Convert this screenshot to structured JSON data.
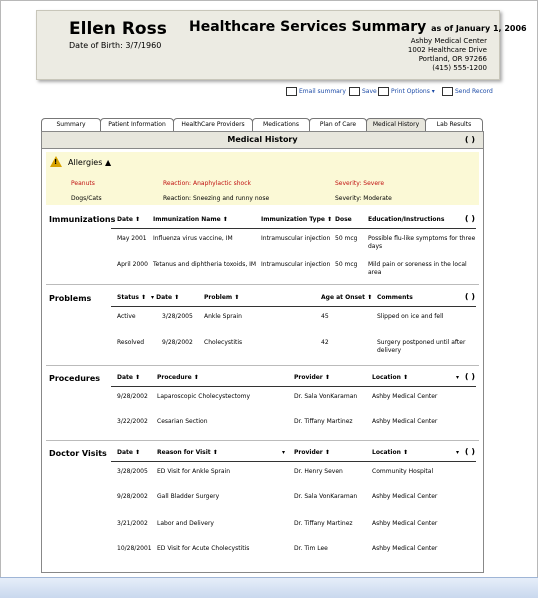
{
  "header": {
    "patient_name": "Ellen Ross",
    "dob": "Date of Birth: 3/7/1960",
    "title": "Healthcare Services Summary",
    "as_of": "as of January 1, 2006",
    "address": [
      "Ashby Medical Center",
      "1002 Healthcare Drive",
      "Portland, OR  97266",
      "(415) 555-1200"
    ]
  },
  "toolbar": {
    "email": "Email summary",
    "save": "Save",
    "print": "Print Options",
    "send": "Send Record"
  },
  "tabs": [
    "Summary",
    "Patient Information",
    "HealthCare Providers",
    "Medications",
    "Plan of Care",
    "Medical History",
    "Lab Results"
  ],
  "active_tab": "Medical History",
  "section_title": "Medical History",
  "allergies": {
    "title": "Allergies",
    "rows": [
      {
        "item": "Peanuts",
        "reaction": "Reaction:  Anaphylactic shock",
        "severity": "Severity:  Severe"
      },
      {
        "item": "Dogs/Cats",
        "reaction": "Reaction:  Sneezing and runny nose",
        "severity": "Severity:  Moderate"
      }
    ]
  },
  "immunizations": {
    "label": "Immunizations",
    "headers": [
      "Date",
      "Immunization Name",
      "Immunization Type",
      "Dose",
      "Education/Instructions"
    ],
    "rows": [
      {
        "date": "May 2001",
        "name": "Influenza virus vaccine, IM",
        "type": "Intramuscular injection",
        "dose": "50 mcg",
        "edu": "Possible flu-like symptoms for three days"
      },
      {
        "date": "April 2000",
        "name": "Tetanus and diphtheria toxoids, IM",
        "type": "Intramuscular injection",
        "dose": "50 mcg",
        "edu": "Mild pain or soreness in the local area"
      }
    ]
  },
  "problems": {
    "label": "Problems",
    "headers": [
      "Status",
      "Date",
      "Problem",
      "Age at Onset",
      "Comments"
    ],
    "rows": [
      {
        "status": "Active",
        "date": "3/28/2005",
        "problem": "Ankle Sprain",
        "age": "45",
        "comments": "Slipped on ice and fell"
      },
      {
        "status": "Resolved",
        "date": "9/28/2002",
        "problem": "Cholecystitis",
        "age": "42",
        "comments": "Surgery postponed until after delivery"
      }
    ]
  },
  "procedures": {
    "label": "Procedures",
    "headers": [
      "Date",
      "Procedure",
      "Provider",
      "Location"
    ],
    "rows": [
      {
        "date": "9/28/2002",
        "procedure": "Laparoscopic Cholecystectomy",
        "provider": "Dr. Sala VonKaraman",
        "location": "Ashby Medical Center"
      },
      {
        "date": "3/22/2002",
        "procedure": "Cesarian Section",
        "provider": "Dr. Tiffany Martinez",
        "location": "Ashby Medical Center"
      }
    ]
  },
  "doctor_visits": {
    "label": "Doctor Visits",
    "headers": [
      "Date",
      "Reason for Visit",
      "Provider",
      "Location"
    ],
    "rows": [
      {
        "date": "3/28/2005",
        "reason": "ED Visit for Ankle Sprain",
        "provider": "Dr. Henry Seven",
        "location": "Community Hospital"
      },
      {
        "date": "9/28/2002",
        "reason": "Gall Bladder Surgery",
        "provider": "Dr. Sala VonKaraman",
        "location": "Ashby Medical Center"
      },
      {
        "date": "3/21/2002",
        "reason": "Labor and Delivery",
        "provider": "Dr. Tiffany Martinez",
        "location": "Ashby Medical Center"
      },
      {
        "date": "10/28/2001",
        "reason": "ED Visit for Acute Cholecystitis",
        "provider": "Dr. Tim Lee",
        "location": "Ashby Medical Center"
      }
    ]
  }
}
